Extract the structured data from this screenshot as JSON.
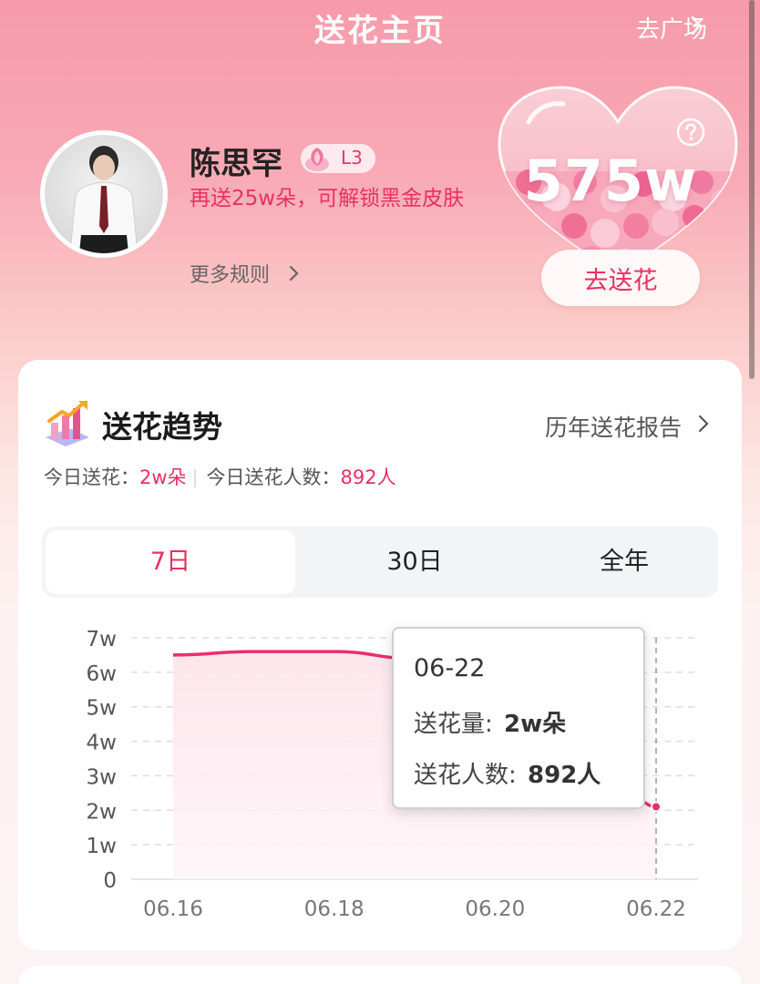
{
  "header": {
    "title": "送花主页",
    "plaza_link": "去广场"
  },
  "profile": {
    "name": "陈思罕",
    "level": "L3",
    "unlock_tip": "再送25w朵，可解锁黑金皮肤",
    "more_rules": "更多规则"
  },
  "heart": {
    "total": "575w",
    "send_button": "去送花"
  },
  "trend": {
    "title": "送花趋势",
    "report_link": "历年送花报告",
    "today_flowers_label": "今日送花：",
    "today_flowers_value": "2w朵",
    "today_people_label": "今日送花人数：",
    "today_people_value": "892人"
  },
  "tabs": [
    {
      "label": "7日",
      "active": true
    },
    {
      "label": "30日",
      "active": false
    },
    {
      "label": "全年",
      "active": false
    }
  ],
  "tooltip": {
    "date": "06-22",
    "flowers_label": "送花量:",
    "flowers_value": "2w朵",
    "people_label": "送花人数:",
    "people_value": "892人"
  },
  "colors": {
    "accent": "#e8305f",
    "line": "#e8306a"
  },
  "chart_data": {
    "type": "line",
    "x": [
      "06.16",
      "06.17",
      "06.18",
      "06.19",
      "06.20",
      "06.21",
      "06.22"
    ],
    "series": [
      {
        "values": [
          6.5,
          6.6,
          6.6,
          6.4,
          6.3,
          6.2,
          2.1
        ]
      }
    ],
    "x_tick_labels": [
      "06.16",
      "06.18",
      "06.20",
      "06.22"
    ],
    "y_ticks": [
      0,
      1,
      2,
      3,
      4,
      5,
      6,
      7
    ],
    "y_tick_labels": [
      "0",
      "1w",
      "2w",
      "3w",
      "4w",
      "5w",
      "6w",
      "7w"
    ],
    "ylim": [
      0,
      7
    ],
    "grid": true,
    "highlight_x": "06.22"
  }
}
